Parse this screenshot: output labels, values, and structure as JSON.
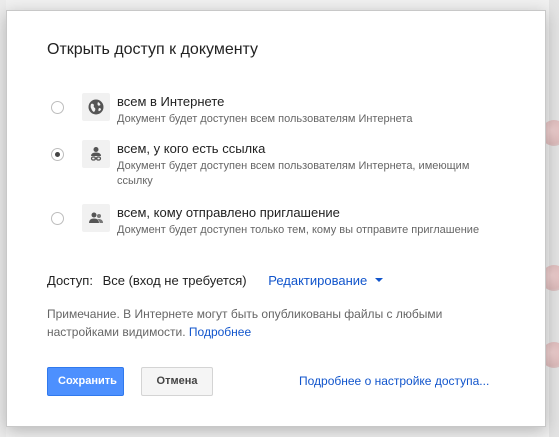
{
  "dialog": {
    "title": "Открыть доступ к документу",
    "options": [
      {
        "icon": "globe-icon",
        "title": "всем в Интернете",
        "description": "Документ будет доступен всем пользователям Интернета",
        "selected": false
      },
      {
        "icon": "link-user-icon",
        "title": "всем, у кого есть ссылка",
        "description": "Документ будет доступен всем пользователям Интернета, имеющим ссылку",
        "selected": true
      },
      {
        "icon": "people-icon",
        "title": "всем, кому отправлено приглашение",
        "description": "Документ будет доступен только тем, кому вы отправите приглашение",
        "selected": false
      }
    ],
    "access": {
      "label": "Доступ:",
      "value": "Все (вход не требуется)",
      "permission": "Редактирование"
    },
    "note": {
      "text": "Примечание. В Интернете могут быть опубликованы файлы с любыми настройками видимости.",
      "link": "Подробнее"
    },
    "buttons": {
      "save": "Сохранить",
      "cancel": "Отмена"
    },
    "help_link": "Подробнее о настройке доступа..."
  },
  "colors": {
    "primary": "#4d90fe",
    "link": "#1155cc"
  }
}
